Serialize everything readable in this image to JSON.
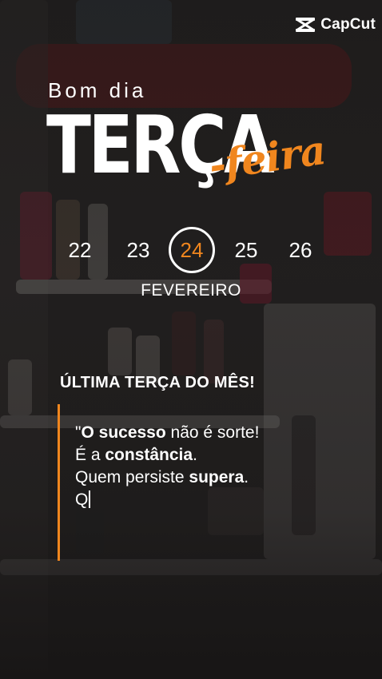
{
  "watermark": {
    "brand": "CapCut",
    "icon": "capcut-logo-icon"
  },
  "greeting": "Bom dia",
  "day_name": "TERÇA",
  "day_suffix": "-feira",
  "calendar": {
    "dates": [
      "22",
      "23",
      "24",
      "25",
      "26"
    ],
    "selected": "24",
    "month": "FEVEREIRO"
  },
  "headline": "ÚLTIMA TERÇA DO MÊS!",
  "quote": {
    "line1_prefix": "\"",
    "line1_bold": "O sucesso",
    "line1_rest": " não é sorte!",
    "line2_prefix": "É a ",
    "line2_bold": "constância",
    "line2_rest": ".",
    "line3_prefix": "Quem persiste ",
    "line3_bold": "supera",
    "line3_rest": ".",
    "line4_typing": "Q"
  },
  "colors": {
    "accent": "#f0861e",
    "text": "#ffffff",
    "background": "#2b2928"
  }
}
